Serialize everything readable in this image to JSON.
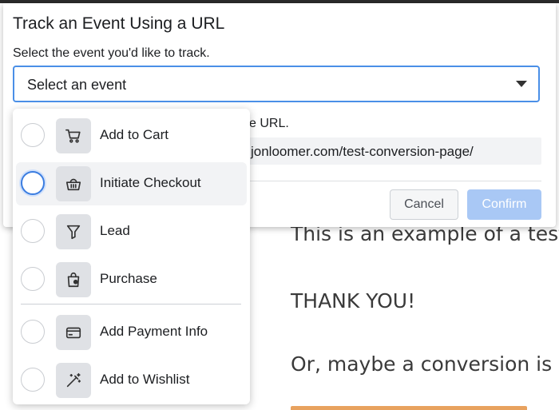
{
  "page": {
    "line1": "This is an example of a test",
    "line2": "THANK YOU!",
    "line3": "Or, maybe a conversion is c"
  },
  "dialog": {
    "title": "Track an Event Using a URL",
    "subtitle": "Select the event you'd like to track.",
    "select_value": "Select an event",
    "url_label": "e URL.",
    "url_value": "jonloomer.com/test-conversion-page/",
    "cancel_label": "Cancel",
    "confirm_label": "Confirm"
  },
  "menu": {
    "items": [
      {
        "label": "Add to Cart",
        "icon": "cart-icon"
      },
      {
        "label": "Initiate Checkout",
        "icon": "basket-icon"
      },
      {
        "label": "Lead",
        "icon": "filter-icon"
      },
      {
        "label": "Purchase",
        "icon": "shopping-bag-icon"
      },
      {
        "label": "Add Payment Info",
        "icon": "credit-card-icon"
      },
      {
        "label": "Add to Wishlist",
        "icon": "magic-wand-icon"
      }
    ]
  },
  "colors": {
    "accent": "#4a8fe7",
    "confirm_disabled": "#a9c8f5",
    "highlight": "#f2f3f5"
  }
}
